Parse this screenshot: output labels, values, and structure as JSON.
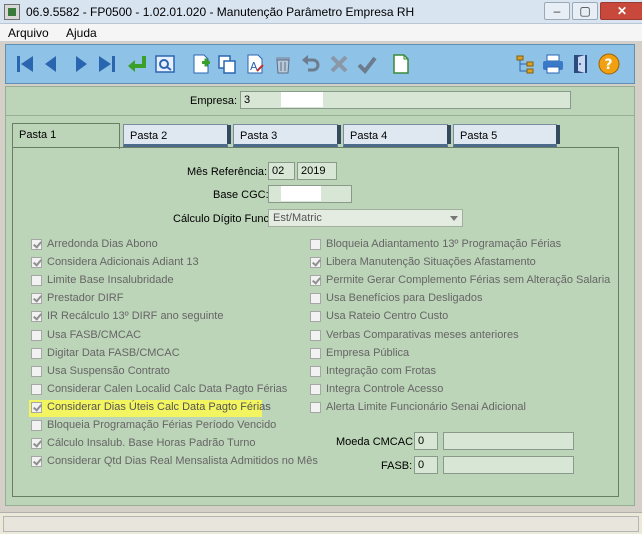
{
  "window": {
    "title": "06.9.5582 - FP0500 - 1.02.01.020 - Manutenção Parâmetro Empresa RH",
    "minimize": "–",
    "maximize": "▢",
    "close": "✕"
  },
  "menu": [
    "Arquivo",
    "Ajuda"
  ],
  "toolbar": {
    "colors": {
      "background": "#8ec2e6",
      "icon": "#2a66b0"
    }
  },
  "empresa": {
    "label": "Empresa:",
    "value": "3"
  },
  "tabs": [
    "Pasta 1",
    "Pasta 2",
    "Pasta 3",
    "Pasta 4",
    "Pasta 5"
  ],
  "mes_referencia": {
    "label": "Mês Referência:",
    "month": "02",
    "year": "2019"
  },
  "base_cgc": {
    "label": "Base CGC:"
  },
  "calculo_digito": {
    "label": "Cálculo Dígito Func:",
    "value": "Est/Matric"
  },
  "left_options": [
    {
      "label": "Arredonda Dias Abono",
      "checked": true
    },
    {
      "label": "Considera Adicionais Adiant 13",
      "checked": true
    },
    {
      "label": "Limite Base Insalubridade",
      "checked": false
    },
    {
      "label": "Prestador DIRF",
      "checked": true
    },
    {
      "label": "IR Recálculo 13º DIRF ano seguinte",
      "checked": true
    },
    {
      "label": "Usa FASB/CMCAC",
      "checked": false
    },
    {
      "label": "Digitar Data FASB/CMCAC",
      "checked": false
    },
    {
      "label": "Usa Suspensão Contrato",
      "checked": false
    },
    {
      "label": "Considerar Calen Localid Calc Data Pagto Férias",
      "checked": false
    },
    {
      "label": "Considerar Dias Úteis Calc Data Pagto Férias",
      "checked": true,
      "highlighted": true
    },
    {
      "label": "Bloqueia Programação Férias Período Vencido",
      "checked": false
    },
    {
      "label": "Cálculo Insalub. Base Horas Padrão Turno",
      "checked": true
    },
    {
      "label": "Considerar Qtd Dias Real Mensalista Admitidos no Mês",
      "checked": true
    }
  ],
  "right_options": [
    {
      "label": "Bloqueia Adiantamento 13º Programação Férias",
      "checked": false
    },
    {
      "label": "Libera Manutenção Situações Afastamento",
      "checked": true
    },
    {
      "label": "Permite Gerar Complemento Férias sem Alteração Salaria",
      "checked": true
    },
    {
      "label": "Usa Benefícios para Desligados",
      "checked": false
    },
    {
      "label": "Usa Rateio Centro Custo",
      "checked": false
    },
    {
      "label": "Verbas Comparativas meses anteriores",
      "checked": false
    },
    {
      "label": "Empresa Pública",
      "checked": false
    },
    {
      "label": "Integração com Frotas",
      "checked": false
    },
    {
      "label": "Integra Controle Acesso",
      "checked": false
    },
    {
      "label": "Alerta Limite Funcionário Senai Adicional",
      "checked": false
    }
  ],
  "moeda_cmcac": {
    "label": "Moeda CMCAC:",
    "value": "0"
  },
  "fasb": {
    "label": "FASB:",
    "value": "0"
  },
  "colors": {
    "form_bg": "#bcd4b8",
    "highlight": "#f3f560",
    "titlebar": "#d9e4f1"
  }
}
